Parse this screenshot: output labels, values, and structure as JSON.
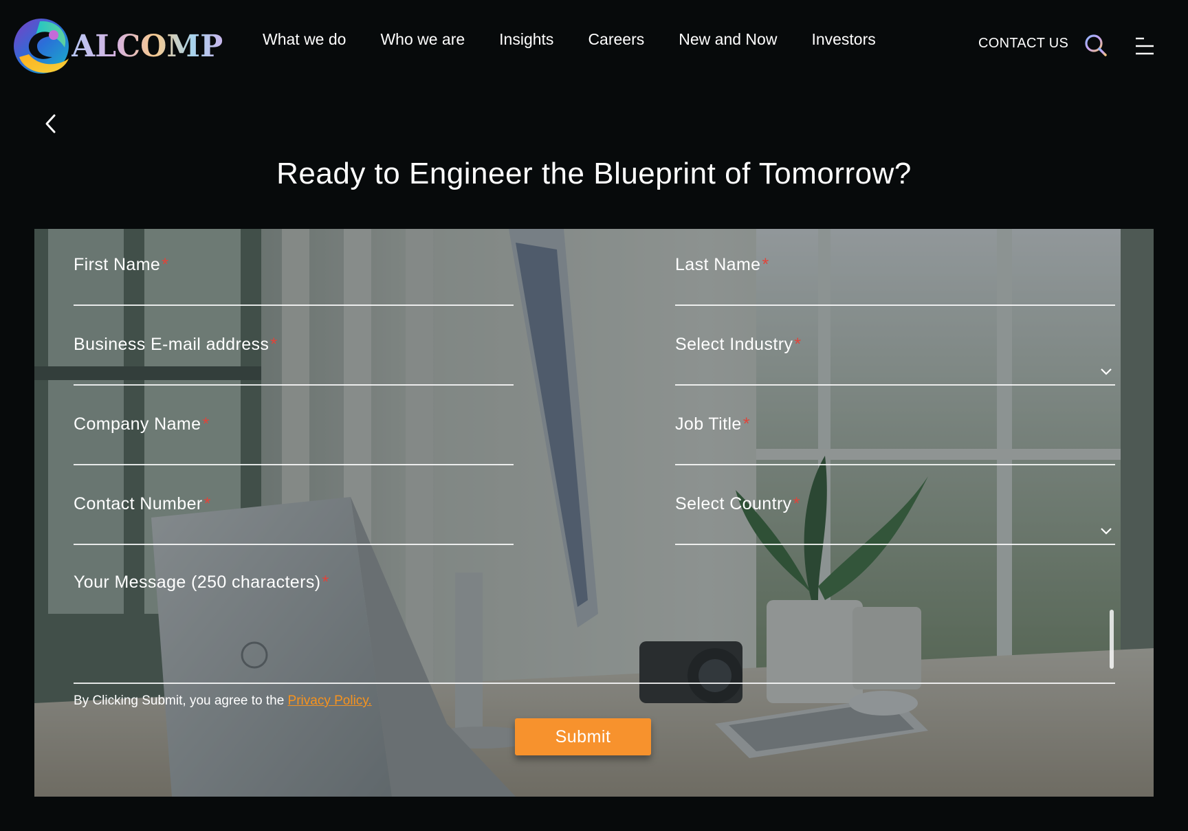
{
  "brand": {
    "name": "ALCOMP"
  },
  "nav": {
    "items": [
      {
        "label": "What we do"
      },
      {
        "label": "Who we are"
      },
      {
        "label": "Insights"
      },
      {
        "label": "Careers"
      },
      {
        "label": "New and Now"
      },
      {
        "label": "Investors"
      }
    ],
    "contact_label": "CONTACT US"
  },
  "page": {
    "title": "Ready to Engineer the Blueprint of Tomorrow?"
  },
  "form": {
    "first_name": {
      "label": "First Name",
      "required": "*"
    },
    "last_name": {
      "label": "Last Name",
      "required": "*"
    },
    "email": {
      "label": "Business E-mail address",
      "required": "*"
    },
    "industry": {
      "label": "Select Industry",
      "required": "*"
    },
    "company": {
      "label": "Company Name",
      "required": "*"
    },
    "job_title": {
      "label": "Job Title",
      "required": "*"
    },
    "contact_number": {
      "label": "Contact Number",
      "required": "*"
    },
    "country": {
      "label": "Select Country",
      "required": "*"
    },
    "message": {
      "label": "Your Message (250 characters)",
      "required": "*"
    },
    "consent_text": "By Clicking Submit, you agree to the",
    "privacy_link": "Privacy Policy.",
    "submit_label": "Submit"
  },
  "icons": {
    "back": "chevron-left-icon",
    "search": "search-icon",
    "menu": "menu-icon",
    "dropdown": "chevron-down-icon"
  },
  "colors": {
    "background": "#070a0b",
    "accent": "#f7922d",
    "required": "#e0443a",
    "link": "#f7931e"
  }
}
